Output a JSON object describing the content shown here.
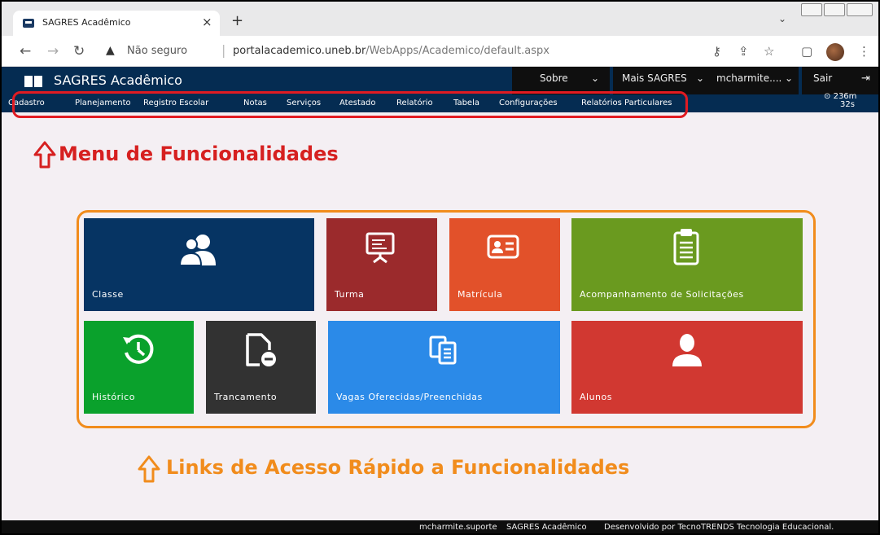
{
  "browser": {
    "tab_title": "SAGRES Acadêmico",
    "tab_close": "×",
    "new_tab": "+",
    "insecure_label": "Não seguro",
    "url_domain": "portalacademico.uneb.br",
    "url_path": "/WebApps/Academico/default.aspx"
  },
  "app": {
    "brand": "SAGRES Acadêmico",
    "topnav": {
      "sobre": "Sobre",
      "mais": "Mais SAGRES",
      "user": "mcharmite....",
      "sair": "Sair"
    },
    "menu": [
      "Cadastro",
      "Planejamento",
      "Registro Escolar",
      "Notas",
      "Serviços",
      "Atestado",
      "Relatório",
      "Tabela",
      "Configurações",
      "Relatórios Particulares"
    ],
    "timer_line1": "236m",
    "timer_line2": "32s"
  },
  "annotations": {
    "menu": "Menu de Funcionalidades",
    "links": "Links de Acesso Rápido a Funcionalidades",
    "menu_color": "#d62020",
    "links_color": "#f18c1c"
  },
  "tiles": [
    {
      "label": "Classe",
      "icon": "users-icon",
      "color": "#063463"
    },
    {
      "label": "Turma",
      "icon": "presentation-board-icon",
      "color": "#9b2a2c"
    },
    {
      "label": "Matrícula",
      "icon": "id-card-icon",
      "color": "#e2512a"
    },
    {
      "label": "Acompanhamento de Solicitações",
      "icon": "clipboard-icon",
      "color": "#6a9a1f"
    },
    {
      "label": "Histórico",
      "icon": "history-clock-icon",
      "color": "#0aa12c"
    },
    {
      "label": "Trancamento",
      "icon": "document-remove-icon",
      "color": "#323232"
    },
    {
      "label": "Vagas Oferecidas/Preenchidas",
      "icon": "copy-documents-icon",
      "color": "#2b8ae8"
    },
    {
      "label": "Alunos",
      "icon": "user-icon",
      "color": "#d13831"
    }
  ],
  "footer": {
    "user": "mcharmite.suporte",
    "app": "SAGRES Acadêmico",
    "credit": "Desenvolvido por TecnoTRENDS Tecnologia Educacional."
  }
}
